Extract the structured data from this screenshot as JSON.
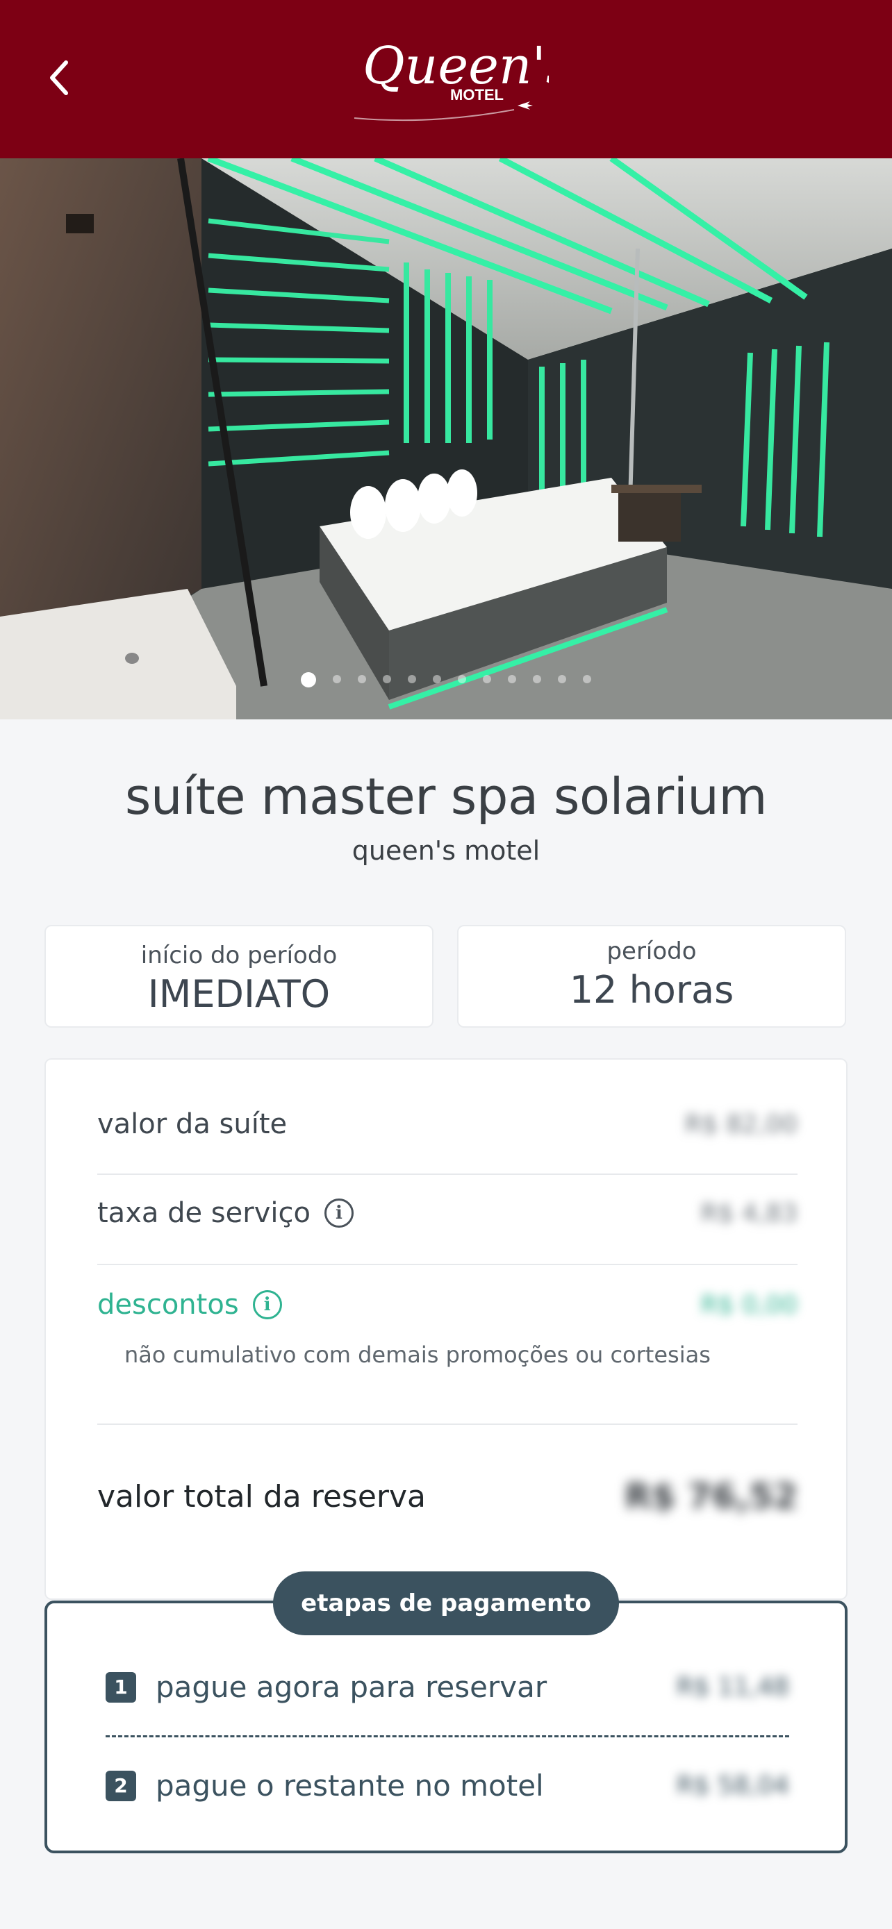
{
  "header": {
    "back_icon": "chevron-left-icon",
    "brand_name": "Queen's",
    "brand_sub": "MOTEL",
    "brand_color": "#7d0014"
  },
  "carousel": {
    "total_photos": 12,
    "active_index": 0
  },
  "suite": {
    "title": "suíte master spa solarium",
    "motel": "queen's motel"
  },
  "booking": {
    "start_label": "início do período",
    "start_value": "IMEDIATO",
    "period_label": "período",
    "period_value": "12 horas"
  },
  "prices": {
    "suite_label": "valor da suíte",
    "suite_value": "R$ 82,00",
    "fee_label": "taxa de serviço",
    "fee_value": "R$ 4,83",
    "discount_label": "descontos",
    "discount_value": "R$ 0,00",
    "discount_note": "não cumulativo com demais promoções ou cortesias",
    "total_label": "valor total da reserva",
    "total_value": "R$ 76,52"
  },
  "payment": {
    "title": "etapas de pagamento",
    "steps": [
      {
        "num": "1",
        "label": "pague agora para reservar",
        "value": "R$ 11,48"
      },
      {
        "num": "2",
        "label": "pague o restante no motel",
        "value": "R$ 58,04"
      }
    ]
  },
  "colors": {
    "accent_green": "#2fb391",
    "steps_dark": "#3b525f"
  }
}
